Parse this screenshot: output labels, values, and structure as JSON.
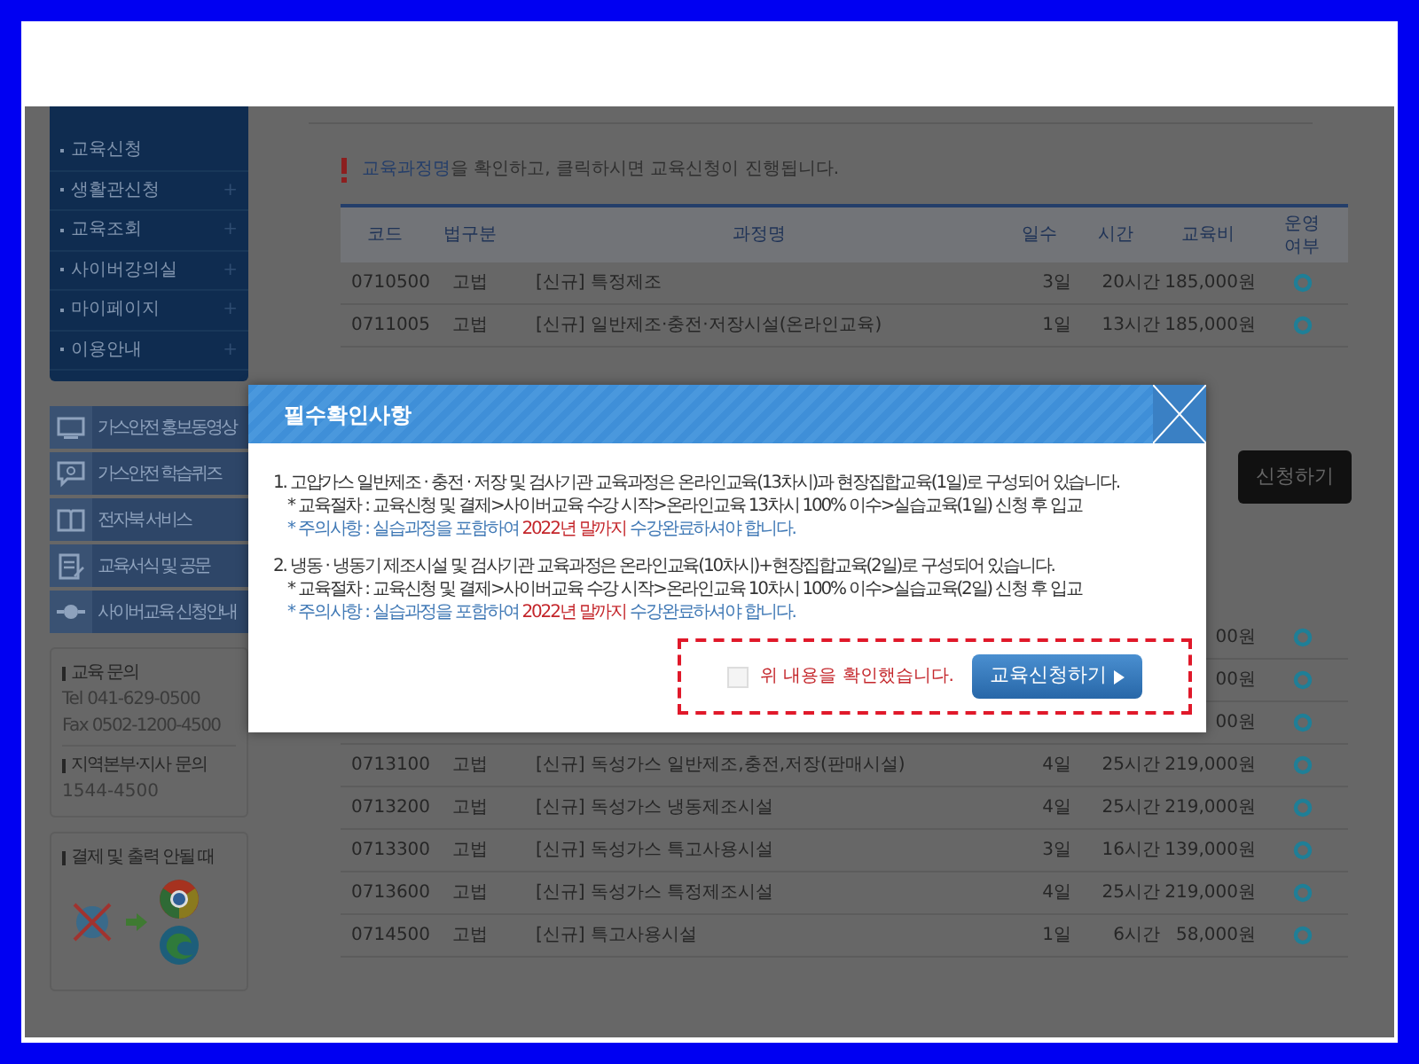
{
  "sidebar": {
    "menu": [
      {
        "label": "교육신청"
      },
      {
        "label": "생활관신청",
        "expand": "+"
      },
      {
        "label": "교육조회",
        "expand": "+"
      },
      {
        "label": "사이버강의실",
        "expand": "+"
      },
      {
        "label": "마이페이지",
        "expand": "+"
      },
      {
        "label": "이용안내",
        "expand": "+"
      }
    ],
    "links": [
      {
        "label": "가스안전 홍보동영상",
        "kind": "video"
      },
      {
        "label": "가스안전 학습퀴즈",
        "kind": "quiz"
      },
      {
        "label": "전자북 서비스",
        "kind": "book"
      },
      {
        "label": "교육서식 및 공문",
        "kind": "form"
      },
      {
        "label": "사이버교육 신청안내",
        "kind": "guide"
      }
    ],
    "contact": {
      "title": "교육 문의",
      "tel": "Tel 041-629-0500",
      "fax": "Fax 0502-1200-4500",
      "branch_title": "지역본부·지사 문의",
      "branch_phone": "1544-4500"
    },
    "browser_help": {
      "title": "결제 및 출력 안될 때"
    }
  },
  "notice": {
    "highlight": "교육과정명",
    "text": "을 확인하고, 클릭하시면 교육신청이 진행됩니다."
  },
  "table": {
    "columns": [
      "코드",
      "법구분",
      "과정명",
      "일수",
      "시간",
      "교육비",
      "운영\n여부"
    ],
    "rows": [
      {
        "code": "0710500",
        "law": "고법",
        "name": "[신규] 특정제조",
        "days": "3일",
        "hours": "20시간",
        "fee": "185,000원"
      },
      {
        "code": "0711005",
        "law": "고법",
        "name": "[신규] 일반제조·충전·저장시설(온라인교육)",
        "days": "1일",
        "hours": "13시간",
        "fee": "185,000원"
      }
    ],
    "apply_button": "신청하기",
    "rows_below": [
      {
        "fee": "00원"
      },
      {
        "fee": "00원"
      },
      {
        "fee": "00원"
      },
      {
        "code": "0713100",
        "law": "고법",
        "name": "[신규] 독성가스 일반제조,충전,저장(판매시설)",
        "days": "4일",
        "hours": "25시간",
        "fee": "219,000원"
      },
      {
        "code": "0713200",
        "law": "고법",
        "name": "[신규] 독성가스 냉동제조시설",
        "days": "4일",
        "hours": "25시간",
        "fee": "219,000원"
      },
      {
        "code": "0713300",
        "law": "고법",
        "name": "[신규] 독성가스 특고사용시설",
        "days": "3일",
        "hours": "16시간",
        "fee": "139,000원"
      },
      {
        "code": "0713600",
        "law": "고법",
        "name": "[신규] 독성가스 특정제조시설",
        "days": "4일",
        "hours": "25시간",
        "fee": "219,000원"
      },
      {
        "code": "0714500",
        "law": "고법",
        "name": "[신규] 특고사용시설",
        "days": "1일",
        "hours": "6시간",
        "fee": "58,000원"
      }
    ]
  },
  "modal": {
    "title": "필수확인사항",
    "items": [
      {
        "main": "1. 고압가스 일반제조 · 충전 · 저장 및 검사기관 교육과정은 온라인교육(13차시)과 현장집합교육(1일)로 구성되어 있습니다.",
        "procedure": "* 교육절차 : 교육신청 및 결제>사이버교육 수강 시작>온라인교육 13차시 100% 이수>실습교육(1일) 신청 후 입교",
        "caution_before": "* 주의사항 : 실습과정을 포함하여",
        "caution_highlight": "2022년 말까지",
        "caution_after": "수강완료하셔야 합니다."
      },
      {
        "main": "2. 냉동 · 냉동기 제조시설 및 검사기관 교육과정은 온라인교육(10차시)+현장집합교육(2일)로 구성되어 있습니다.",
        "procedure": "* 교육절차 : 교육신청 및 결제>사이버교육 수강 시작>온라인교육 10차시 100% 이수>실습교육(2일) 신청 후 입교",
        "caution_before": "* 주의사항 : 실습과정을 포함하여",
        "caution_highlight": "2022년 말까지",
        "caution_after": "수강완료하셔야 합니다."
      }
    ],
    "confirm": {
      "label": "위 내용을 확인했습니다.",
      "checked": false
    },
    "submit": "교육신청하기"
  }
}
